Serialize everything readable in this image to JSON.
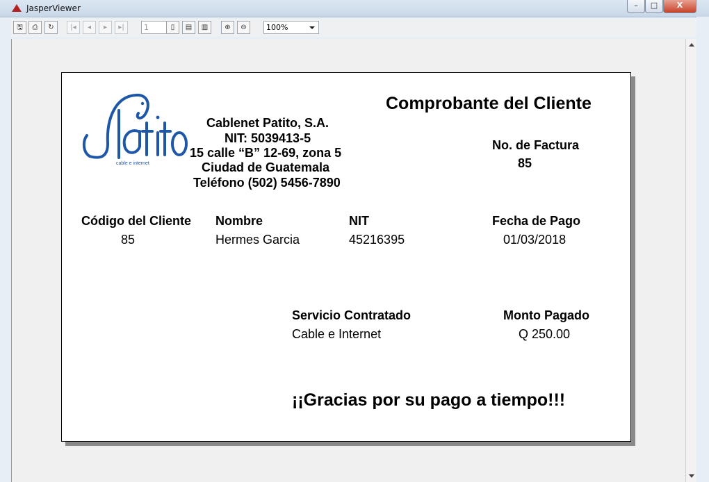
{
  "window": {
    "title": "JasperViewer",
    "min_label": "–",
    "max_label": "□",
    "close_label": "X"
  },
  "toolbar": {
    "page_number": "1",
    "zoom_value": "100%"
  },
  "report": {
    "logo_text": "Patito",
    "logo_subtext": "cable e internet",
    "title": "Comprobante del Cliente",
    "company": {
      "name": "Cablenet Patito, S.A.",
      "nit": "NIT: 5039413-5",
      "address": "15 calle “B” 12-69, zona 5",
      "city": "Ciudad de Guatemala",
      "phone": "Teléfono (502) 5456-7890"
    },
    "invoice": {
      "label": "No. de Factura",
      "value": "85"
    },
    "client_code": {
      "label": "Código del Cliente",
      "value": "85"
    },
    "name": {
      "label": "Nombre",
      "value": "Hermes Garcia"
    },
    "nit": {
      "label": "NIT",
      "value": "45216395"
    },
    "payment_date": {
      "label": "Fecha de Pago",
      "value": "01/03/2018"
    },
    "service": {
      "label": "Servicio Contratado",
      "value": "Cable e Internet"
    },
    "amount": {
      "label": "Monto Pagado",
      "value": "Q 250.00"
    },
    "thanks": "¡¡Gracias por su pago a tiempo!!!"
  },
  "colors": {
    "logo_blue": "#1f57a8",
    "close_red": "#c7422a"
  }
}
